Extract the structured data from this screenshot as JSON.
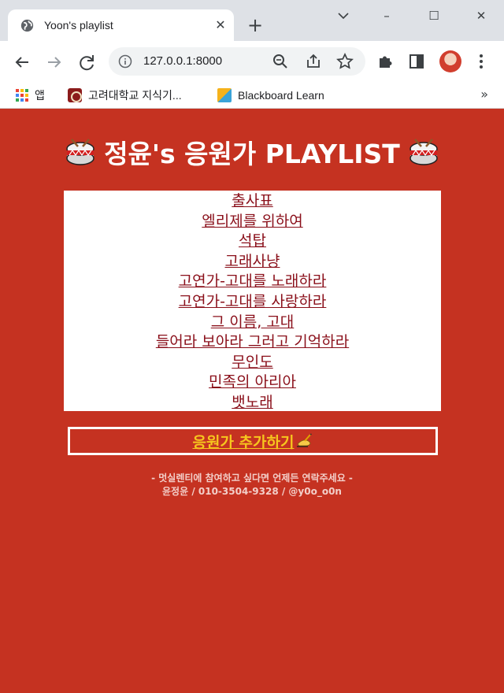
{
  "browser": {
    "tab_title": "Yoon's playlist",
    "tab_close": "✕",
    "new_tab": "+",
    "window_controls": {
      "minimize": "–",
      "maximize": "☐",
      "close": "✕"
    },
    "url": "127.0.0.1:8000",
    "bookmarks": [
      {
        "label": "앱",
        "icon": "apps-grid-icon"
      },
      {
        "label": "고려대학교 지식기...",
        "icon": "korea-university-crest-icon"
      },
      {
        "label": "Blackboard Learn",
        "icon": "blackboard-icon"
      }
    ],
    "bookmarks_more": "»"
  },
  "page": {
    "title": "정윤's 응원가 PLAYLIST",
    "title_icon": "drum-icon",
    "songs": [
      "출사표",
      "엘리제를 위하여",
      "석탑",
      "고래사냥",
      "고연가-고대를 노래하라",
      "고연가-고대를 사랑하라",
      "그 이름, 고대",
      "들어라 보아라 그러고 기억하라",
      "무인도",
      "민족의 아리아",
      "뱃노래"
    ],
    "add_button": "응원가 추가하기",
    "add_button_icon": "writing-hand-icon",
    "footer_line1": "- 멋실렌티에 참여하고 싶다면 언제든 연락주세요 -",
    "footer_line2": "윤정윤 / 010-3504-9328 / @y0o_o0n"
  },
  "colors": {
    "page_background": "#c53221",
    "link_color": "#8a0f1a",
    "button_text": "#f6c51e",
    "tabstrip": "#dee1e6"
  }
}
